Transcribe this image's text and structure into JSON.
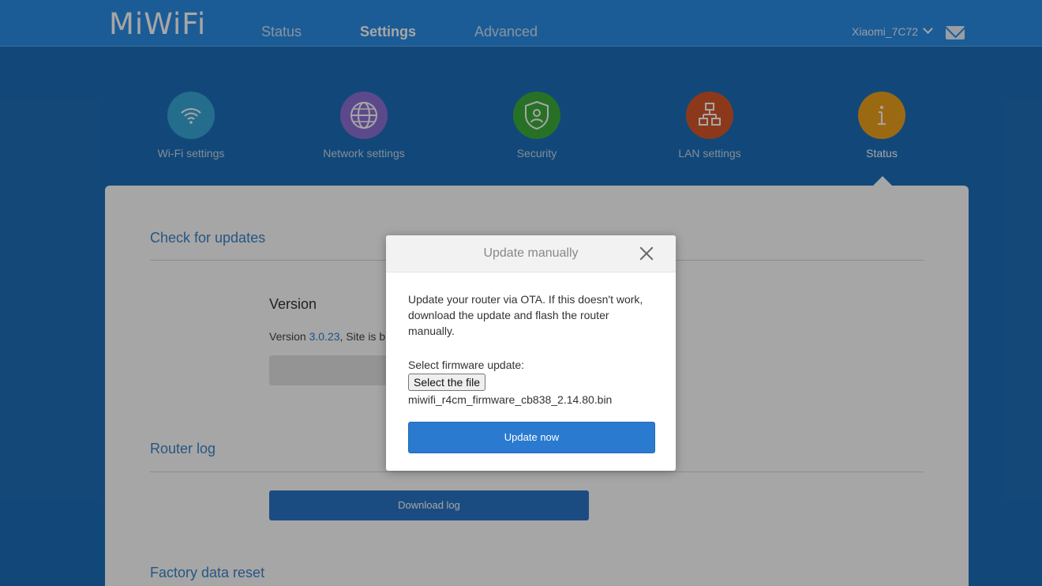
{
  "header": {
    "logo": "MiWiFi",
    "nav": [
      {
        "label": "Status"
      },
      {
        "label": "Settings"
      },
      {
        "label": "Advanced"
      }
    ],
    "active_nav": "Settings",
    "user": "Xiaomi_7C72",
    "mail_icon": "mail-icon"
  },
  "sections": [
    {
      "label": "Wi-Fi settings",
      "icon": "wifi-icon",
      "color": "#3aa8d8"
    },
    {
      "label": "Network settings",
      "icon": "globe-icon",
      "color": "#8e70d6"
    },
    {
      "label": "Security",
      "icon": "shield-icon",
      "color": "#3cae3c"
    },
    {
      "label": "LAN settings",
      "icon": "network-icon",
      "color": "#d8582a"
    },
    {
      "label": "Status",
      "icon": "info-icon",
      "color": "#f0a21e"
    }
  ],
  "active_section": "Status",
  "main": {
    "updates": {
      "title": "Check for updates",
      "subtitle": "Version",
      "version_prefix": "Version ",
      "version": "3.0.23",
      "version_suffix": ", Site is bu"
    },
    "log": {
      "title": "Router log",
      "download_label": "Download log"
    },
    "reset": {
      "title": "Factory data reset"
    }
  },
  "modal": {
    "title": "Update manually",
    "description": "Update your router via OTA. If this doesn't work, download the update and flash the router manually.",
    "firmware_label": "Select firmware update:",
    "file_button": "Select the file",
    "file_name": "miwifi_r4cm_firmware_cb838_2.14.80.bin",
    "update_button": "Update now"
  },
  "colors": {
    "topbar": "#2b8ee6",
    "background": "#1d6fba",
    "accent": "#2a7ad0"
  }
}
